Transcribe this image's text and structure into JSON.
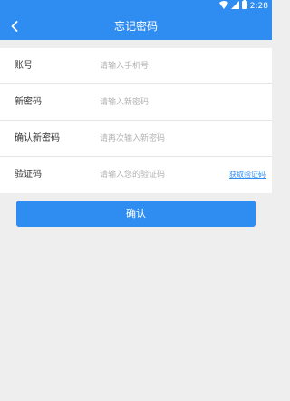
{
  "status_bar": {
    "time": "2:28",
    "icons": [
      "wifi-icon",
      "signal-icon",
      "battery-icon"
    ]
  },
  "header": {
    "title": "忘记密码",
    "back_icon": "chevron-left-icon"
  },
  "form": {
    "account": {
      "label": "账号",
      "placeholder": "请输入手机号"
    },
    "new_password": {
      "label": "新密码",
      "placeholder": "请输入新密码"
    },
    "confirm_password": {
      "label": "确认新密码",
      "placeholder": "请再次输入新密码"
    },
    "code": {
      "label": "验证码",
      "placeholder": "请输入您的验证码",
      "get_code_label": "获取验证码"
    }
  },
  "confirm_button": {
    "label": "确认"
  },
  "colors": {
    "primary": "#2f8cf0",
    "background": "#eeeeee",
    "placeholder": "#b3b3b3",
    "label": "#333333"
  }
}
